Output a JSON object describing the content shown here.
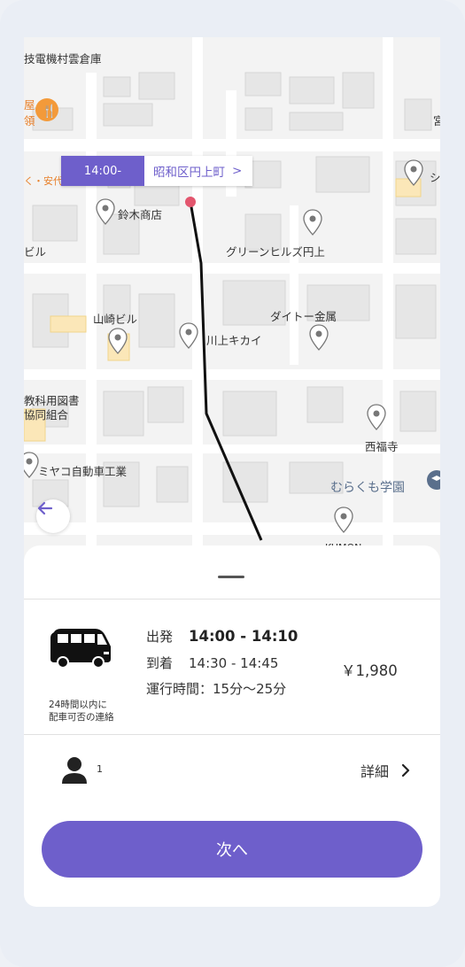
{
  "map": {
    "labels": {
      "tl": "技電機村雲倉庫",
      "suzuki": "鈴木商店",
      "bil": "ビル",
      "greenhills": "グリーンヒルズ円上",
      "yamazaki": "山崎ビル",
      "daito": "ダイトー金属",
      "kawakami": "川上キカイ",
      "kyokasho1": "教科用図書",
      "kyokasho2": "協同組合",
      "miyako": "ミヤコ自動車工業",
      "saifukuji": "西福寺",
      "murakumo": "むらくも学園",
      "kumon": "KUMON",
      "left_orange1": "屋",
      "left_orange2": "領",
      "left_orange3": "く・安代",
      "right_edge1": "宮",
      "right_edge2": "シ"
    },
    "departure_tag": {
      "time": "14:00-",
      "place": "昭和区円上町",
      "chevron": ">"
    }
  },
  "sheet": {
    "trip": {
      "notice_line1": "24時間以内に",
      "notice_line2": "配車可否の連絡",
      "depart_label": "出発",
      "depart_time": "14:00 - 14:10",
      "arrive_label": "到着",
      "arrive_time": "14:30 - 14:45",
      "duration": "運行時間：15分〜25分",
      "price": "￥1,980"
    },
    "passengers": {
      "count": "1",
      "details_label": "詳細",
      "chevron": ">"
    },
    "next_button": "次へ"
  },
  "colors": {
    "accent": "#6e5fcb",
    "route": "#111111",
    "origin_dot": "#e3566e"
  }
}
